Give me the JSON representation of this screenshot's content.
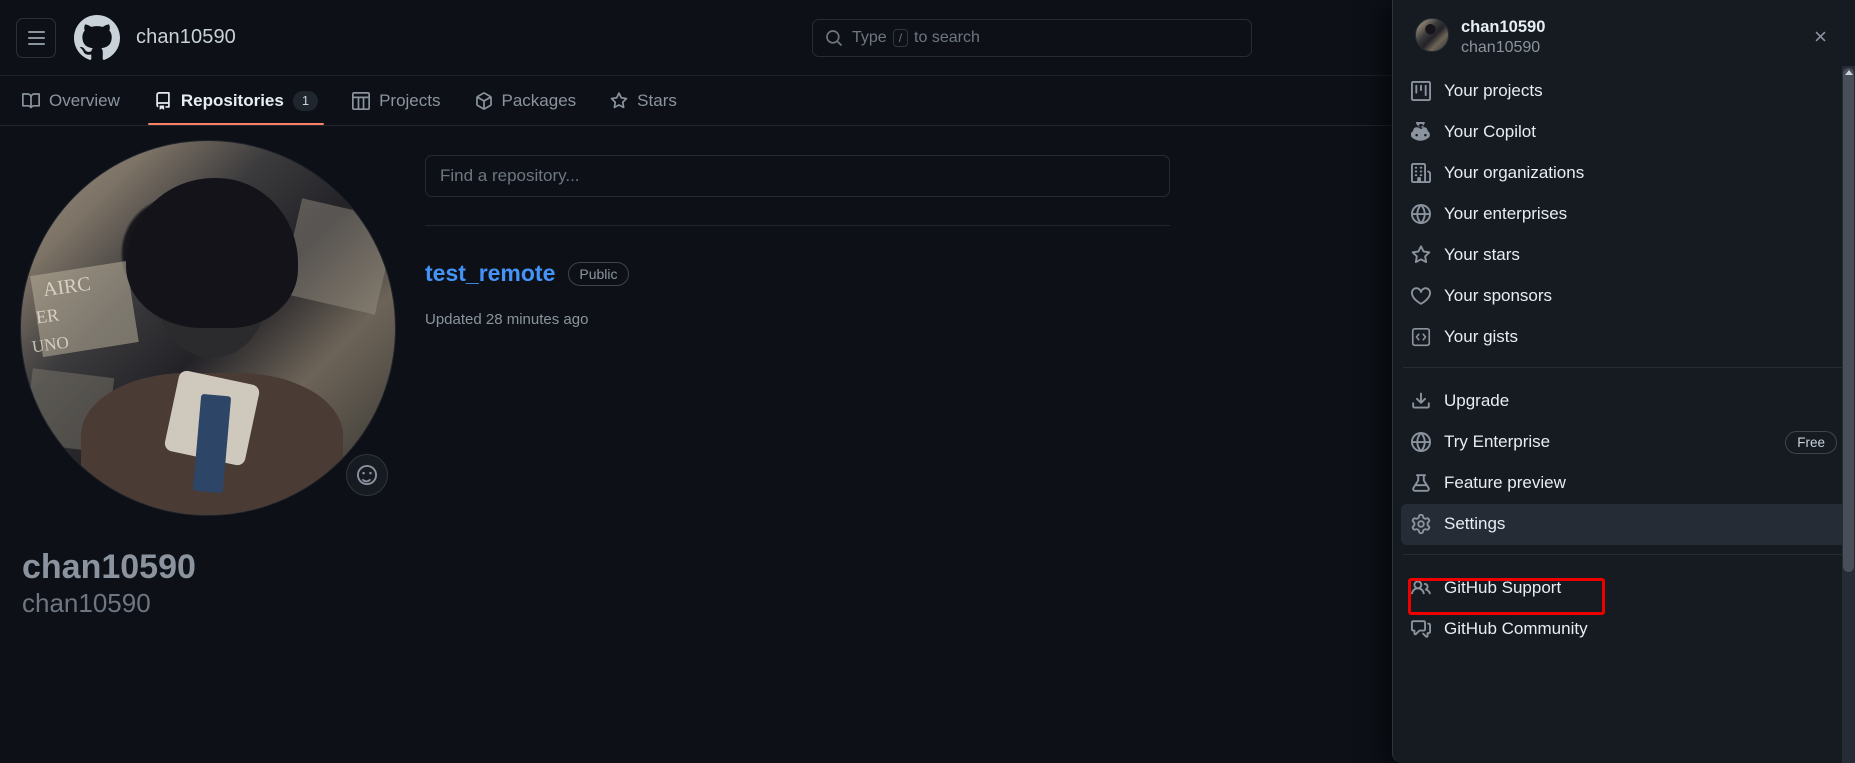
{
  "header": {
    "menu_button": "hamburger-menu",
    "logo": "github-logo",
    "owner": "chan10590",
    "search": {
      "placeholder_prefix": "Type",
      "key": "/",
      "placeholder_suffix": "to search"
    }
  },
  "nav": {
    "items": [
      {
        "label": "Overview",
        "icon": "book-icon",
        "count": null,
        "active": false
      },
      {
        "label": "Repositories",
        "icon": "repo-icon",
        "count": "1",
        "active": true
      },
      {
        "label": "Projects",
        "icon": "table-icon",
        "count": null,
        "active": false
      },
      {
        "label": "Packages",
        "icon": "package-icon",
        "count": null,
        "active": false
      },
      {
        "label": "Stars",
        "icon": "star-icon",
        "count": null,
        "active": false
      }
    ]
  },
  "profile": {
    "avatar_alt": "user-avatar",
    "emoji_button": "smiley-icon",
    "name": "chan10590",
    "login": "chan10590"
  },
  "repos": {
    "search_placeholder": "Find a repository...",
    "list": [
      {
        "name": "test_remote",
        "visibility": "Public",
        "updated": "Updated 28 minutes ago"
      }
    ]
  },
  "user_menu": {
    "name": "chan10590",
    "login": "chan10590",
    "close_label": "✕",
    "groups": [
      {
        "items": [
          {
            "label": "Your projects",
            "icon": "project-icon"
          },
          {
            "label": "Your Copilot",
            "icon": "copilot-icon"
          },
          {
            "label": "Your organizations",
            "icon": "organization-icon"
          },
          {
            "label": "Your enterprises",
            "icon": "globe-icon"
          },
          {
            "label": "Your stars",
            "icon": "star-icon"
          },
          {
            "label": "Your sponsors",
            "icon": "heart-icon"
          },
          {
            "label": "Your gists",
            "icon": "code-icon"
          }
        ]
      },
      {
        "items": [
          {
            "label": "Upgrade",
            "icon": "upload-icon"
          },
          {
            "label": "Try Enterprise",
            "icon": "globe-icon",
            "badge": "Free"
          },
          {
            "label": "Feature preview",
            "icon": "beaker-icon"
          },
          {
            "label": "Settings",
            "icon": "gear-icon",
            "selected": true
          }
        ]
      },
      {
        "items": [
          {
            "label": "GitHub Support",
            "icon": "people-icon"
          },
          {
            "label": "GitHub Community",
            "icon": "comment-discussion-icon"
          }
        ]
      }
    ]
  },
  "colors": {
    "page_bg": "#0d1117",
    "panel_bg": "#161b22",
    "accent_link": "#4493f8",
    "tab_underline": "#f78166",
    "highlight_box": "#ee0000",
    "selected_row": "#262c36"
  }
}
